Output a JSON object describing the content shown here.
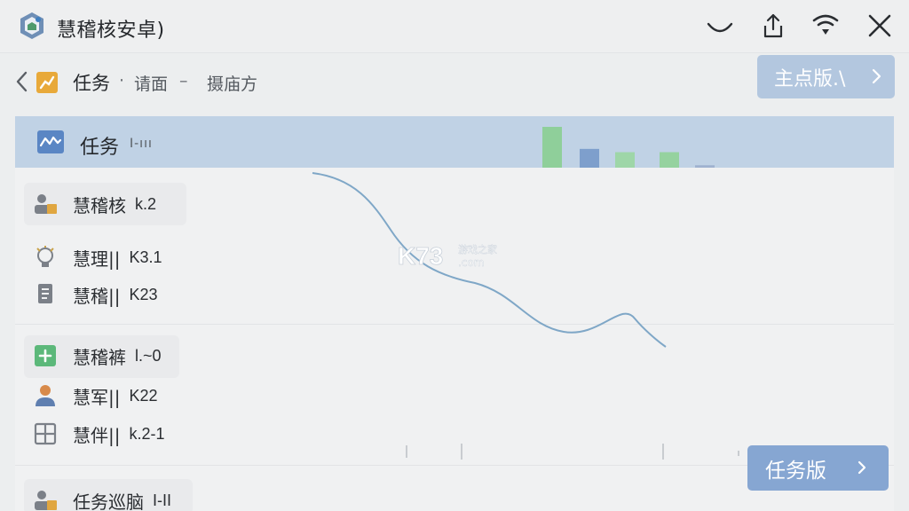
{
  "app": {
    "title": "慧稽核安卓)",
    "icons": [
      "app-logo-icon",
      "minimize-icon",
      "share-icon",
      "wifi-icon",
      "close-icon"
    ]
  },
  "toolbar": {
    "title": "任务",
    "separator": "·",
    "subtitle": "请面",
    "dash": "–",
    "extra": "摄庙方",
    "version_button": "主点版.\\"
  },
  "panel_header": {
    "label": "任务",
    "tag": "I-ııı"
  },
  "mini_chart": {
    "values": [
      1.0,
      0.46,
      0.38,
      0.38,
      0.06
    ],
    "colors": [
      "#8fcf9a",
      "#7e9fcc",
      "#9ed6a8",
      "#95d29f",
      "#9fb2d0"
    ]
  },
  "groups": [
    {
      "items": [
        {
          "icon": "user-at-desk-icon",
          "label": "慧稽核",
          "code": "k.2"
        }
      ]
    },
    {
      "items": [
        {
          "icon": "lightbulb-icon",
          "label": "慧理||",
          "code": "K3.1"
        },
        {
          "icon": "document-icon",
          "label": "慧稽||",
          "code": "K23"
        }
      ]
    },
    {
      "items": [
        {
          "icon": "plus-icon",
          "label": "慧稽裤",
          "code": "l.~0"
        },
        {
          "icon": "person-icon",
          "label": "慧军||",
          "code": "K22"
        },
        {
          "icon": "grid-icon",
          "label": "慧伴||",
          "code": "k.2-1"
        }
      ]
    },
    {
      "items": [
        {
          "icon": "user-at-desk-icon",
          "label": "任务巡脑",
          "code": "I-II"
        }
      ]
    }
  ],
  "watermark": {
    "brand": "K73",
    "cn": "游戏之家",
    "domain": ".com"
  },
  "task_button": "任务版",
  "colors": {
    "header_row": "#c0d2e5",
    "version_button": "#b3c7df",
    "task_button": "#86a6d2",
    "curve": "#7fa7c7"
  }
}
